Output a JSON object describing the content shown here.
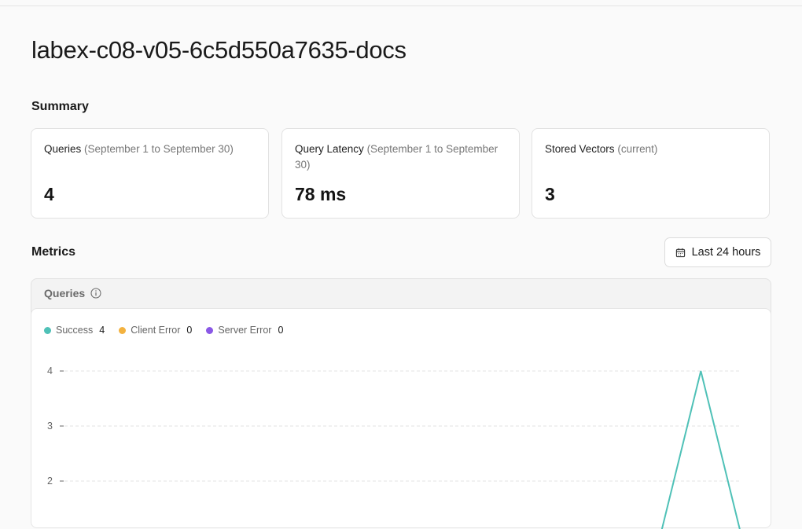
{
  "page": {
    "title": "labex-c08-v05-6c5d550a7635-docs"
  },
  "summary": {
    "title": "Summary",
    "cards": [
      {
        "label": "Queries",
        "range": "(September 1 to September 30)",
        "value": "4"
      },
      {
        "label": "Query Latency",
        "range": "(September 1 to September 30)",
        "value": "78 ms"
      },
      {
        "label": "Stored Vectors",
        "range": "(current)",
        "value": "3"
      }
    ]
  },
  "metrics": {
    "title": "Metrics",
    "range_button": {
      "label": "Last 24 hours",
      "icon": "calendar-icon"
    },
    "panel": {
      "title": "Queries",
      "info_icon": "info-icon",
      "legend": [
        {
          "name": "Success",
          "count": "4",
          "color": "#4fc1b7"
        },
        {
          "name": "Client Error",
          "count": "0",
          "color": "#f3b23f"
        },
        {
          "name": "Server Error",
          "count": "0",
          "color": "#8a58e6"
        }
      ]
    }
  },
  "chart_data": {
    "type": "line",
    "series": [
      {
        "name": "Success",
        "color": "#4fc1b7",
        "points": [
          [
            0.88,
            1
          ],
          [
            0.94,
            4
          ],
          [
            1.0,
            1
          ]
        ]
      }
    ],
    "yticks": [
      4,
      3,
      2
    ],
    "ylim": [
      1,
      4
    ],
    "grid": true
  }
}
